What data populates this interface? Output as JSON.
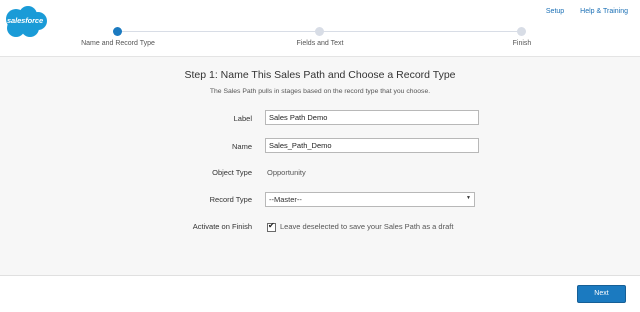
{
  "brand": {
    "logo_text": "salesforce",
    "logo_color": "#1a9bd7"
  },
  "header": {
    "links": [
      "Setup",
      "Help & Training"
    ]
  },
  "progress": {
    "steps": [
      {
        "label": "Name and Record Type",
        "state": "active"
      },
      {
        "label": "Fields and Text",
        "state": "pending"
      },
      {
        "label": "Finish",
        "state": "pending"
      }
    ],
    "active_color": "#1b7ac0",
    "inactive_color": "#d8dde6"
  },
  "form": {
    "title": "Step 1: Name This Sales Path and Choose a Record Type",
    "subtitle": "The Sales Path pulls in stages based on the record type that you choose.",
    "label_field": {
      "label": "Label",
      "value": "Sales Path Demo"
    },
    "name_field": {
      "label": "Name",
      "value": "Sales_Path_Demo"
    },
    "object_type": {
      "label": "Object Type",
      "value": "Opportunity"
    },
    "record_type": {
      "label": "Record Type",
      "selected": "--Master--"
    },
    "activate": {
      "label": "Activate on Finish",
      "checked": true,
      "help_text": "Leave deselected to save your Sales Path as a draft"
    }
  },
  "footer": {
    "next_label": "Next",
    "button_color": "#1b7ac0"
  }
}
